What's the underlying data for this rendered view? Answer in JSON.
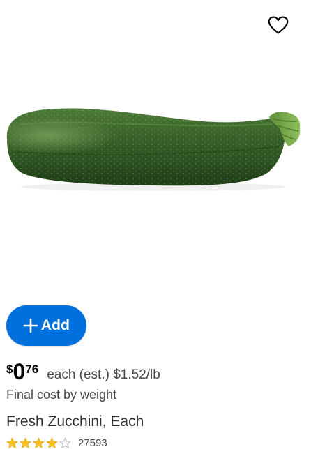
{
  "product": {
    "favorite_icon": "heart-outline-icon",
    "image_alt": "zucchini-image",
    "add_button": {
      "icon": "plus-icon",
      "label": "Add",
      "color": "#0071dc"
    },
    "price": {
      "currency": "$",
      "whole": "0",
      "cents": "76",
      "unit_text": "each (est.) $1.52/lb"
    },
    "final_cost_note": "Final cost by weight",
    "title": "Fresh Zucchini, Each",
    "rating": {
      "stars": 4,
      "out_of": 5,
      "star_color": "#ffc220",
      "review_count": "27593"
    }
  }
}
